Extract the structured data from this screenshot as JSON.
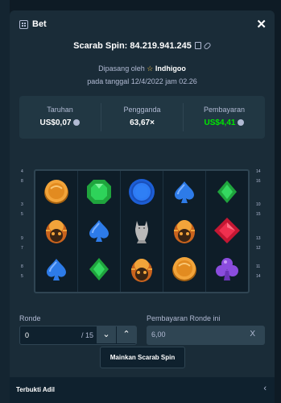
{
  "modal": {
    "title": "Bet",
    "close_icon": "close-icon"
  },
  "game": {
    "title": "Scarab Spin: 84.219.941.245",
    "placed_by_prefix": "Dipasang oleh",
    "user": "Indhigoo",
    "date": "pada tanggal 12/4/2022 jam 02.26"
  },
  "stats": {
    "bet_label": "Taruhan",
    "bet_value": "US$0,07",
    "multiplier_label": "Pengganda",
    "multiplier_value": "63,67×",
    "payout_label": "Pembayaran",
    "payout_value": "US$4,41",
    "payout_color": "#00e701"
  },
  "reels": {
    "left_numbers": [
      "4",
      "8",
      "3",
      "5",
      "9",
      "7",
      "8",
      "5"
    ],
    "right_numbers": [
      "14",
      "16",
      "10",
      "15",
      "13",
      "12",
      "11",
      "14"
    ],
    "columns": [
      [
        "coin",
        "scarab",
        "spade"
      ],
      [
        "emerald",
        "spade",
        "emerald"
      ],
      [
        "sapphire",
        "cat",
        "scarab"
      ],
      [
        "spade",
        "scarab",
        "coin"
      ],
      [
        "emerald",
        "ruby",
        "club"
      ]
    ]
  },
  "controls": {
    "round_label": "Ronde",
    "round_value": "0",
    "round_total": "/ 15",
    "round_payout_label": "Pembayaran Ronde ini",
    "round_payout_value": "6,00",
    "round_payout_suffix": "X",
    "play_button": "Mainkan Scarab Spin"
  },
  "footer": {
    "label": "Terbukti Adil"
  }
}
